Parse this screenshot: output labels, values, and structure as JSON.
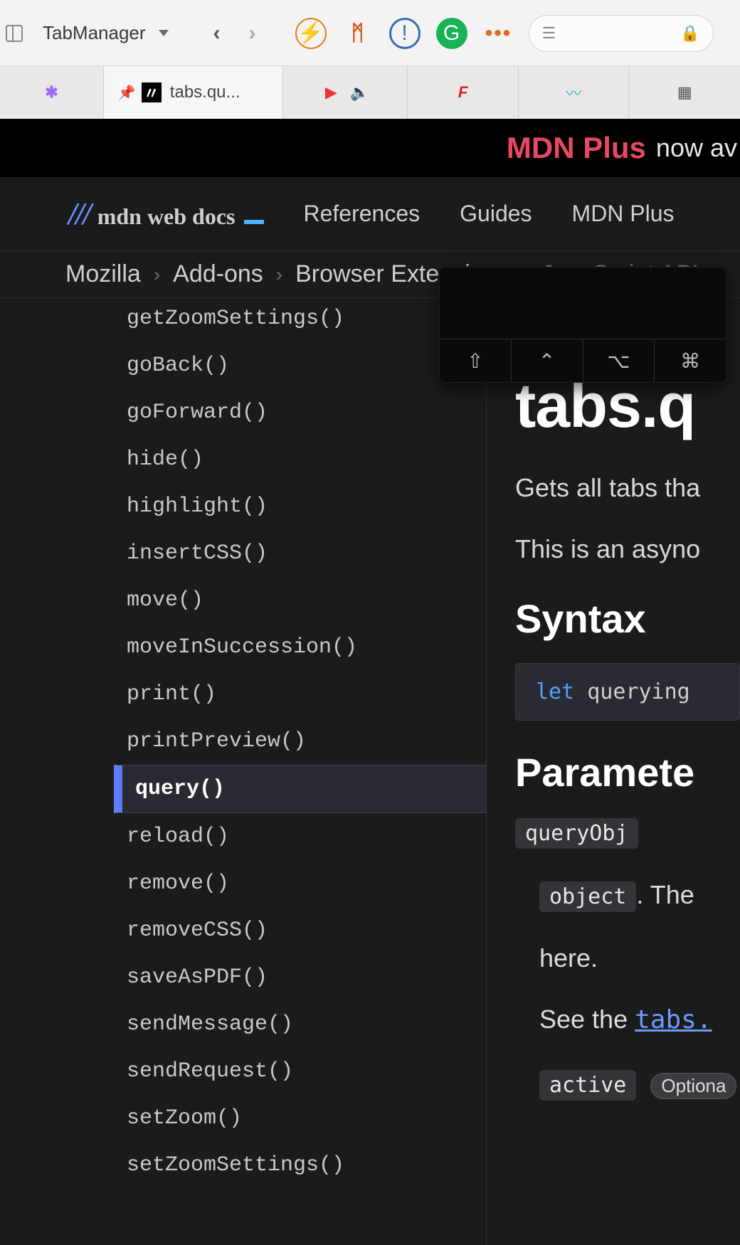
{
  "browser": {
    "tabmanager_label": "TabManager",
    "tabs": [
      {
        "label": ""
      },
      {
        "label": "tabs.qu..."
      },
      {
        "label": ""
      },
      {
        "label": ""
      },
      {
        "label": ""
      },
      {
        "label": ""
      }
    ]
  },
  "banner": {
    "brand": "MDN Plus",
    "rest": "now av"
  },
  "nav": {
    "logo_text": "mdn web docs",
    "items": [
      "References",
      "Guides",
      "MDN Plus"
    ]
  },
  "breadcrumb": [
    "Mozilla",
    "Add-ons",
    "Browser Extensions",
    "JavaScript APIs"
  ],
  "sidebar": {
    "items": [
      "getZoomSettings()",
      "goBack()",
      "goForward()",
      "hide()",
      "highlight()",
      "insertCSS()",
      "move()",
      "moveInSuccession()",
      "print()",
      "printPreview()",
      "query()",
      "reload()",
      "remove()",
      "removeCSS()",
      "saveAsPDF()",
      "sendMessage()",
      "sendRequest()",
      "setZoom()",
      "setZoomSettings()"
    ],
    "active_index": 10
  },
  "article": {
    "title": "tabs.q",
    "intro1": "Gets all tabs tha",
    "intro2": "This is an asyno",
    "h2_syntax": "Syntax",
    "code_let": "let",
    "code_rest": " querying",
    "h2_params": "Paramete",
    "param_name": "queryObj",
    "param_type": "object",
    "param_sentence": ". The ",
    "param_here": "here.",
    "see_the": "See the ",
    "tabs_link": "tabs.",
    "active_code": "active",
    "optional_badge": "Optiona"
  },
  "overlay_keys": [
    "⇧",
    "⌃",
    "⌥",
    "⌘"
  ]
}
